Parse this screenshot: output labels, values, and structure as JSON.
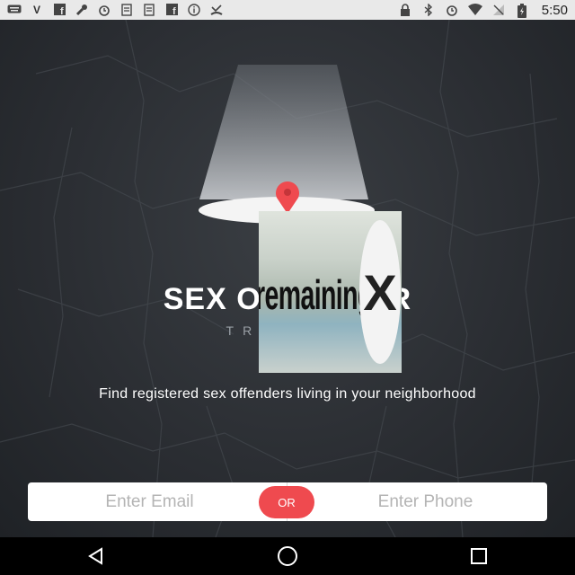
{
  "status_bar": {
    "time": "5:50",
    "left_icons": [
      "keyboard-icon",
      "v-icon",
      "facebook-icon",
      "wrench-icon",
      "alarm-icon",
      "notes-icon",
      "notes-icon",
      "facebook-icon",
      "info-icon",
      "missed-call-icon"
    ],
    "right_icons": [
      "lock-icon",
      "bluetooth-icon",
      "alarm-icon",
      "wifi-icon",
      "no-signal-icon",
      "battery-charging-icon"
    ]
  },
  "app": {
    "title": "SEX OFFENDER",
    "subtitle": "TRACKER",
    "description": "Find registered sex offenders living in your neighborhood",
    "email_placeholder": "Enter Email",
    "or_label": "OR",
    "phone_placeholder": "Enter Phone",
    "accent_color": "#ef4a4f"
  },
  "ad_overlay": {
    "text": "remaining",
    "close_glyph": "X"
  },
  "nav_bar": {
    "buttons": [
      "back-icon",
      "home-icon",
      "recents-icon"
    ]
  }
}
